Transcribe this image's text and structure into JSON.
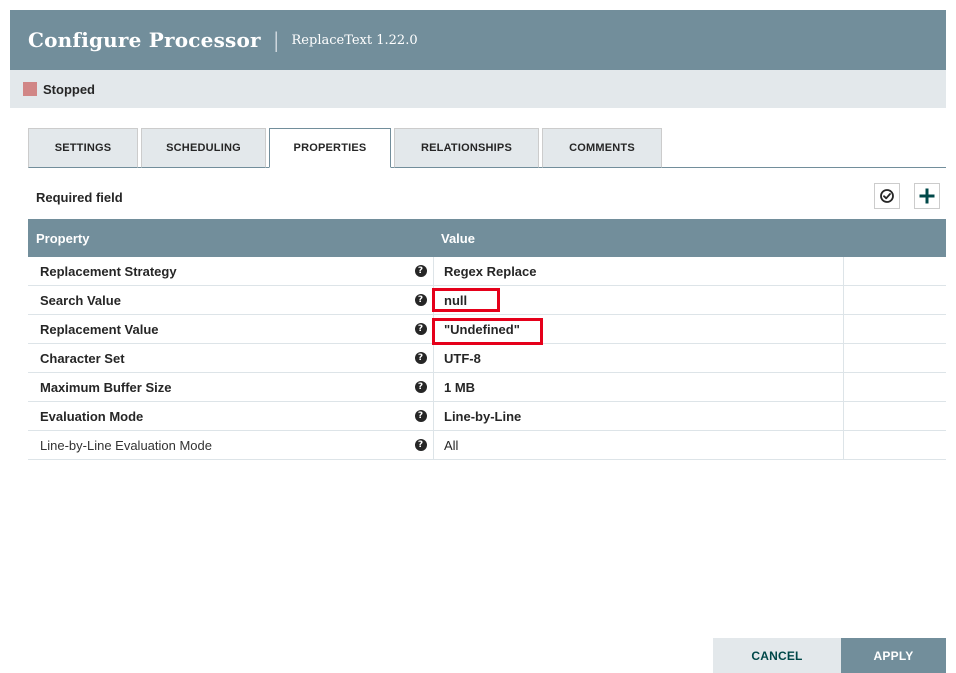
{
  "dialog": {
    "title": "Configure Processor",
    "separator": "|",
    "subtitle": "ReplaceText 1.22.0"
  },
  "status": {
    "label": "Stopped",
    "color": "#d18686"
  },
  "tabs": [
    {
      "label": "SETTINGS",
      "active": false
    },
    {
      "label": "SCHEDULING",
      "active": false
    },
    {
      "label": "PROPERTIES",
      "active": true
    },
    {
      "label": "RELATIONSHIPS",
      "active": false
    },
    {
      "label": "COMMENTS",
      "active": false
    }
  ],
  "properties_panel": {
    "required_label": "Required field",
    "verify_icon": "check-circle-icon",
    "add_icon": "plus-icon",
    "columns": {
      "property": "Property",
      "value": "Value"
    },
    "rows": [
      {
        "name": "Replacement Strategy",
        "value": "Regex Replace",
        "required": true
      },
      {
        "name": "Search Value",
        "value": "null",
        "required": true
      },
      {
        "name": "Replacement Value",
        "value": "\"Undefined\"",
        "required": true
      },
      {
        "name": "Character Set",
        "value": "UTF-8",
        "required": true
      },
      {
        "name": "Maximum Buffer Size",
        "value": "1 MB",
        "required": true
      },
      {
        "name": "Evaluation Mode",
        "value": "Line-by-Line",
        "required": true
      },
      {
        "name": "Line-by-Line Evaluation Mode",
        "value": "All",
        "required": false
      }
    ],
    "help_glyph": "?"
  },
  "footer": {
    "cancel_label": "CANCEL",
    "apply_label": "APPLY"
  },
  "colors": {
    "header_bg": "#728e9b",
    "status_bg": "#e3e8eb",
    "highlight": "#e5001a"
  }
}
